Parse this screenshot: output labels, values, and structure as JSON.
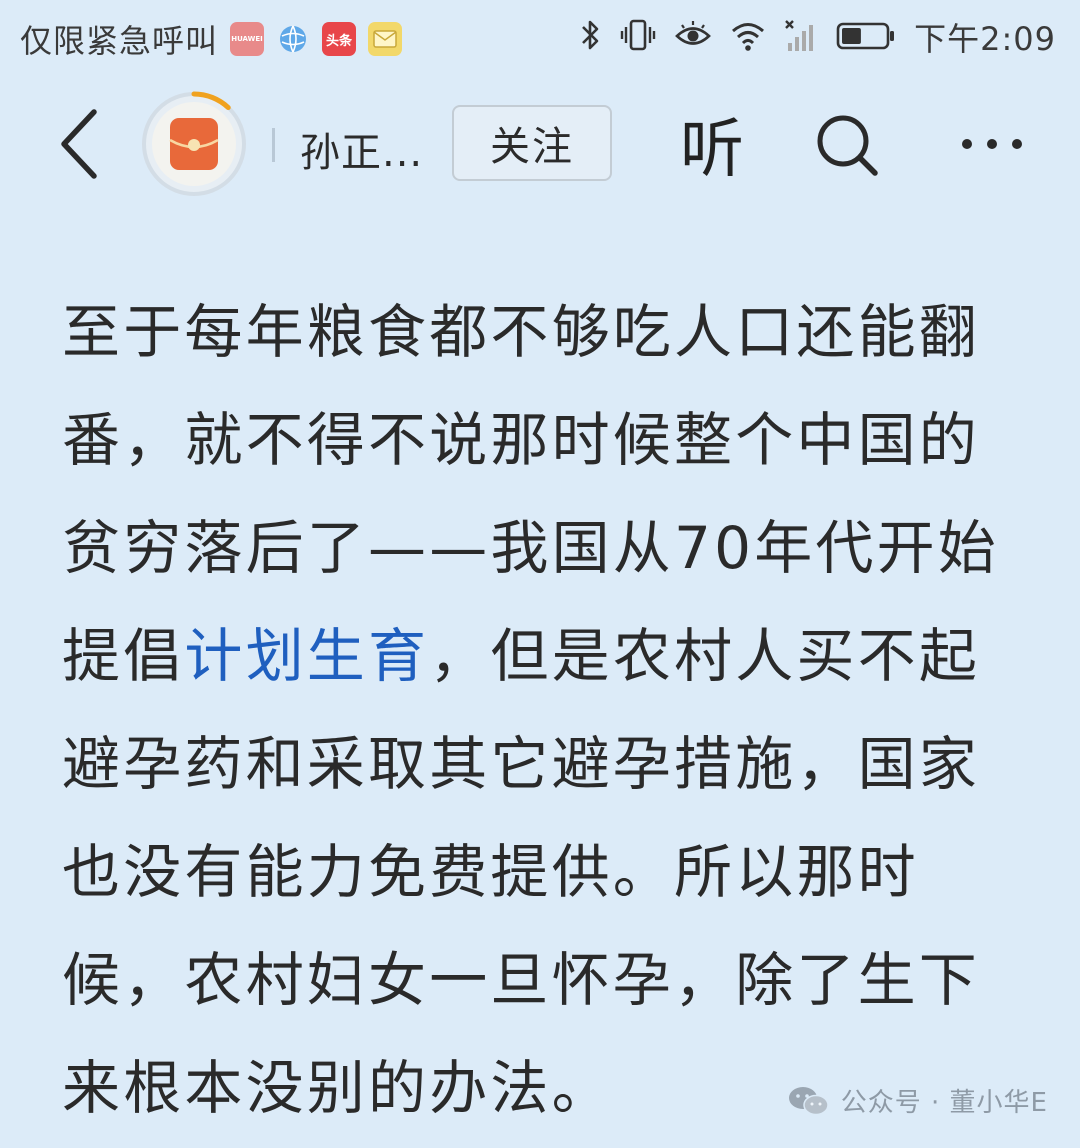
{
  "status_bar": {
    "carrier_text": "仅限紧急呼叫",
    "app_icons": [
      "huawei-store-icon",
      "globe-icon",
      "toutiao-icon",
      "mail-icon"
    ],
    "toutiao_badge": "头条",
    "huawei_badge": "HUAWEI",
    "system_icons": [
      "bluetooth-icon",
      "vibrate-icon",
      "eye-comfort-icon",
      "wifi-icon",
      "no-signal-icon",
      "battery-icon"
    ],
    "battery_level": 0.45,
    "time": "下午2:09"
  },
  "nav_bar": {
    "author_name": "孙正...",
    "follow_label": "关注",
    "listen_label": "听",
    "avatar_progress": 0.12
  },
  "article": {
    "lines": [
      {
        "text": "至于每年粮食都不够吃人口还能翻"
      },
      {
        "text": "番，就不得不说那时候整个中国的"
      },
      {
        "text": "贫穷落后了——我国从70年代开始"
      },
      {
        "before": "提倡",
        "link": "计划生育",
        "after": "，但是农村人买不起"
      },
      {
        "text": "避孕药和采取其它避孕措施，国家"
      },
      {
        "text": "也没有能力免费提供。所以那时"
      },
      {
        "text": "候，农村妇女一旦怀孕，除了生下"
      },
      {
        "text": "来根本没别的办法。"
      }
    ]
  },
  "watermark": {
    "text": "公众号 · 董小华E",
    "icon": "wechat-icon"
  },
  "colors": {
    "background": "#dcebf8",
    "link": "#1f5fbf",
    "avatar_ring": "#f0a21f",
    "avatar_fill": "#e8693a"
  }
}
